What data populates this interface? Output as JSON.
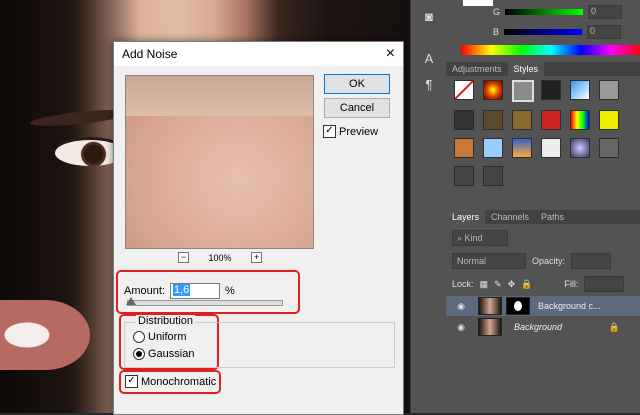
{
  "dialog": {
    "title": "Add Noise",
    "close": "×",
    "ok_label": "OK",
    "cancel_label": "Cancel",
    "preview_label": "Preview",
    "preview_checked": true,
    "zoom_level": "100%",
    "zoom_out": "−",
    "zoom_in": "+",
    "amount_label": "Amount:",
    "amount_value": "1,6",
    "amount_unit": "%",
    "distribution_title": "Distribution",
    "uniform_label": "Uniform",
    "gaussian_label": "Gaussian",
    "selected_distribution": "Gaussian",
    "monochromatic_label": "Monochromatic",
    "monochromatic_checked": true
  },
  "color_panel": {
    "g_label": "G",
    "b_label": "B",
    "g_value": "0",
    "b_value": "0"
  },
  "tabs_top": [
    "Adjustments",
    "Styles"
  ],
  "tabs_layers": [
    "Layers",
    "Channels",
    "Paths"
  ],
  "layers_panel": {
    "kind_label": "Kind",
    "blend_mode": "Normal",
    "opacity_label": "Opacity:",
    "lock_label": "Lock:",
    "fill_label": "Fill:"
  },
  "layers": [
    {
      "name": "Background c...",
      "selected": true,
      "has_mask": true
    },
    {
      "name": "Background",
      "selected": false,
      "has_mask": false
    }
  ],
  "colors": {
    "highlight_red": "#e02020",
    "accent_blue": "#0078d7",
    "selection": "#3399ff"
  }
}
